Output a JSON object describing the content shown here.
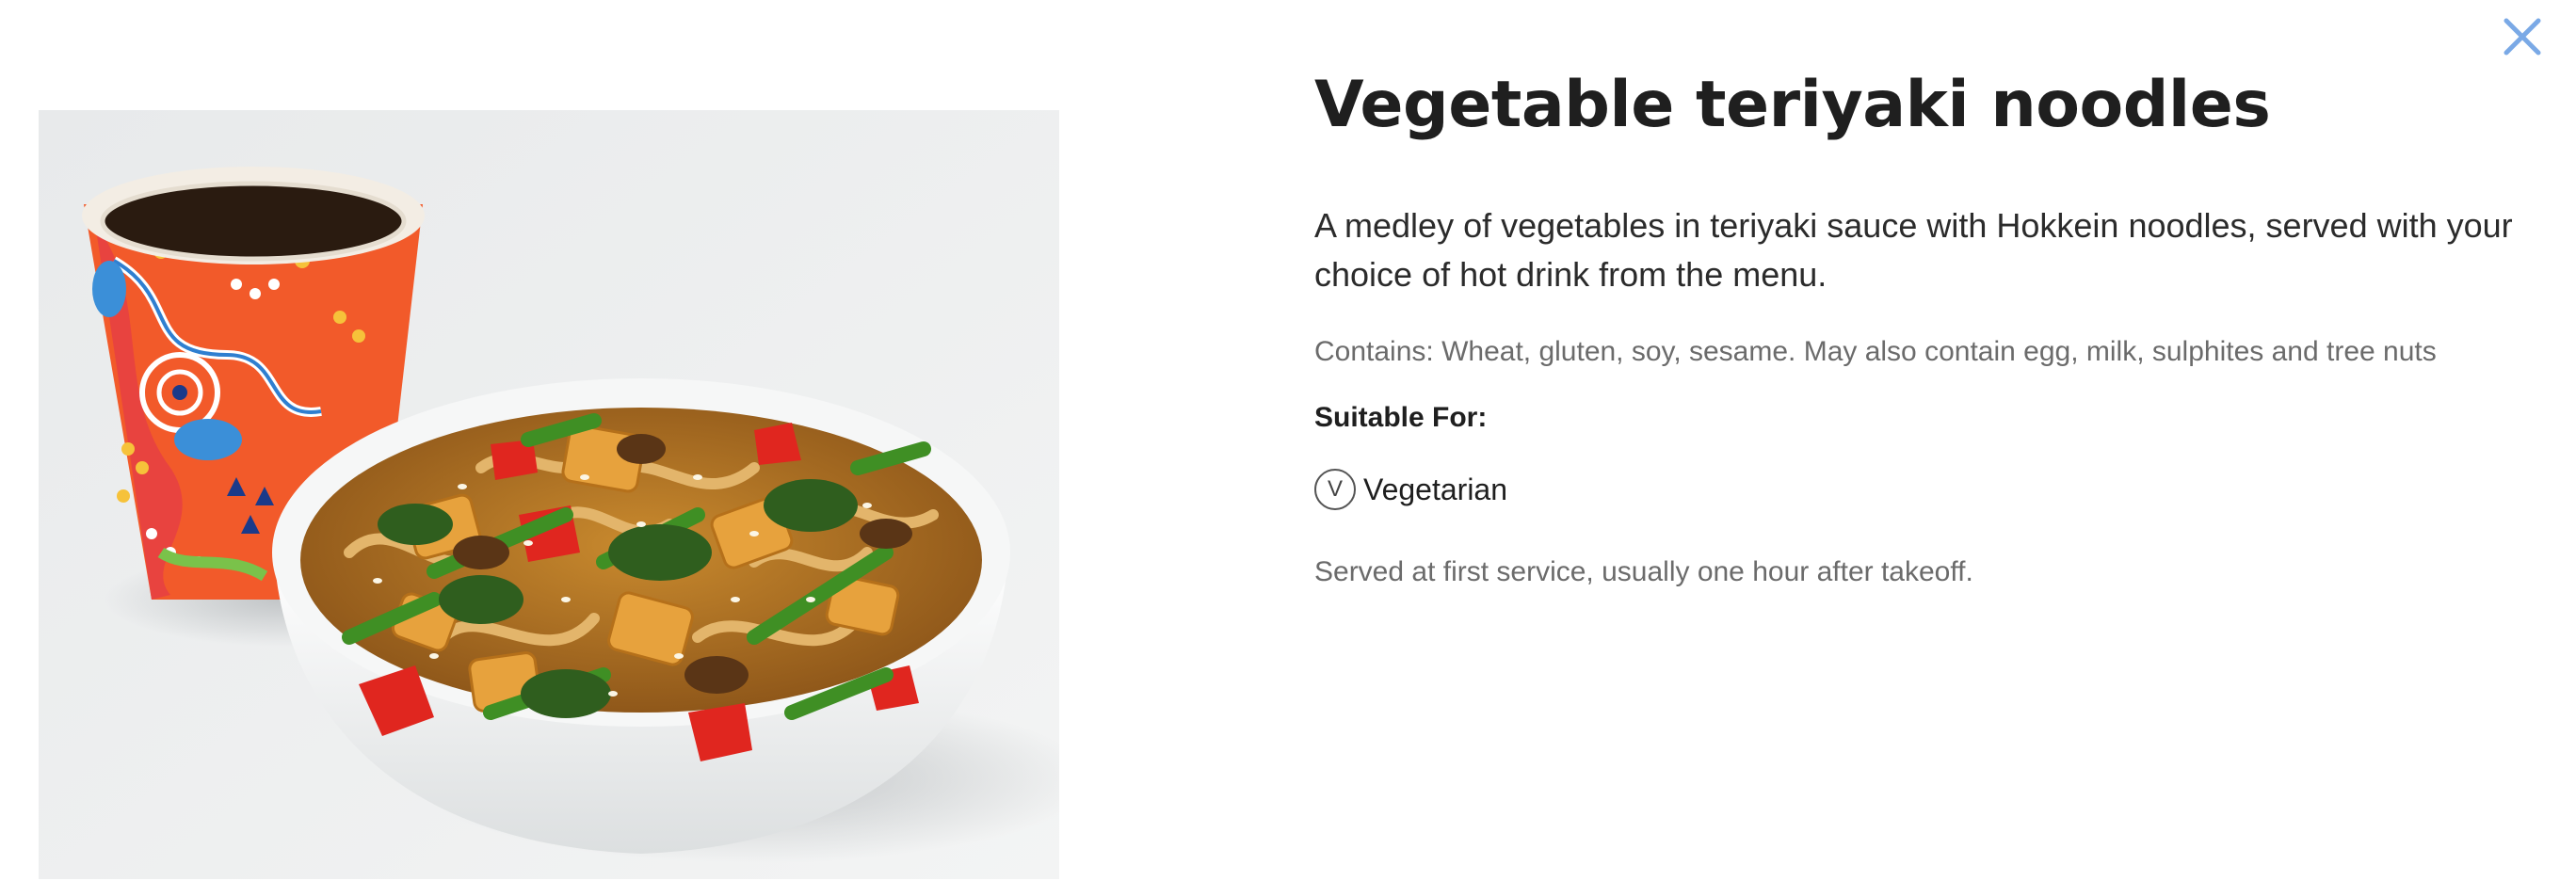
{
  "modal": {
    "close_icon": "close-icon",
    "accent_color": "#7aa9e6"
  },
  "meal": {
    "title": "Vegetable teriyaki noodles",
    "description": "A medley of vegetables in teriyaki sauce with Hokkein noodles, served with your choice of hot drink from the menu.",
    "allergens": "Contains: Wheat, gluten, soy, sesame. May also contain egg, milk, sulphites and tree nuts",
    "suitable_for_heading": "Suitable For:",
    "suitable_for": [
      {
        "badge": "V",
        "label": "Vegetarian"
      }
    ],
    "service_note": "Served at first service, usually one hour after takeoff."
  },
  "colors": {
    "title": "#1f1f1f",
    "muted_text": "#6b6b6b",
    "body_text": "#2b2b2b"
  }
}
